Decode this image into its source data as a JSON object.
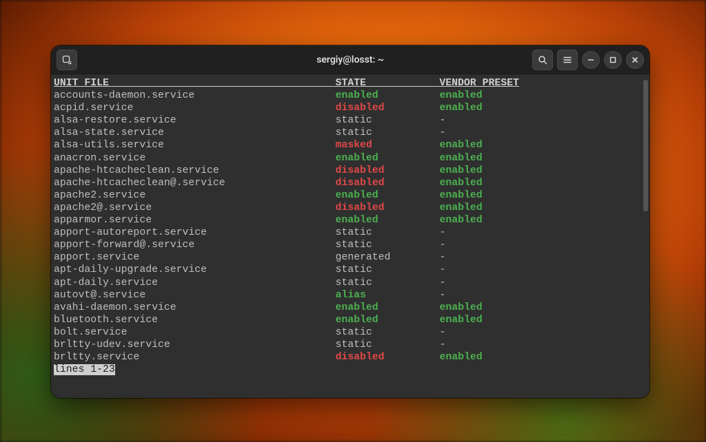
{
  "window": {
    "title": "sergiy@losst: ~"
  },
  "header": {
    "col_unit": "UNIT FILE",
    "col_state": "STATE",
    "col_preset": "VENDOR PRESET"
  },
  "rows": [
    {
      "unit": "accounts-daemon.service",
      "state": "enabled",
      "preset": "enabled"
    },
    {
      "unit": "acpid.service",
      "state": "disabled",
      "preset": "enabled"
    },
    {
      "unit": "alsa-restore.service",
      "state": "static",
      "preset": "-"
    },
    {
      "unit": "alsa-state.service",
      "state": "static",
      "preset": "-"
    },
    {
      "unit": "alsa-utils.service",
      "state": "masked",
      "preset": "enabled"
    },
    {
      "unit": "anacron.service",
      "state": "enabled",
      "preset": "enabled"
    },
    {
      "unit": "apache-htcacheclean.service",
      "state": "disabled",
      "preset": "enabled"
    },
    {
      "unit": "apache-htcacheclean@.service",
      "state": "disabled",
      "preset": "enabled"
    },
    {
      "unit": "apache2.service",
      "state": "enabled",
      "preset": "enabled"
    },
    {
      "unit": "apache2@.service",
      "state": "disabled",
      "preset": "enabled"
    },
    {
      "unit": "apparmor.service",
      "state": "enabled",
      "preset": "enabled"
    },
    {
      "unit": "apport-autoreport.service",
      "state": "static",
      "preset": "-"
    },
    {
      "unit": "apport-forward@.service",
      "state": "static",
      "preset": "-"
    },
    {
      "unit": "apport.service",
      "state": "generated",
      "preset": "-"
    },
    {
      "unit": "apt-daily-upgrade.service",
      "state": "static",
      "preset": "-"
    },
    {
      "unit": "apt-daily.service",
      "state": "static",
      "preset": "-"
    },
    {
      "unit": "autovt@.service",
      "state": "alias",
      "preset": "-"
    },
    {
      "unit": "avahi-daemon.service",
      "state": "enabled",
      "preset": "enabled"
    },
    {
      "unit": "bluetooth.service",
      "state": "enabled",
      "preset": "enabled"
    },
    {
      "unit": "bolt.service",
      "state": "static",
      "preset": "-"
    },
    {
      "unit": "brltty-udev.service",
      "state": "static",
      "preset": "-"
    },
    {
      "unit": "brltty.service",
      "state": "disabled",
      "preset": "enabled"
    }
  ],
  "pager": "lines 1-23",
  "columns": {
    "unit_pad": 46,
    "state_pad": 17
  },
  "state_class": {
    "enabled": "st-enabled",
    "disabled": "st-disabled",
    "masked": "st-masked",
    "alias": "st-alias",
    "static": "st-static",
    "generated": "st-generated",
    "-": "st-dash"
  }
}
